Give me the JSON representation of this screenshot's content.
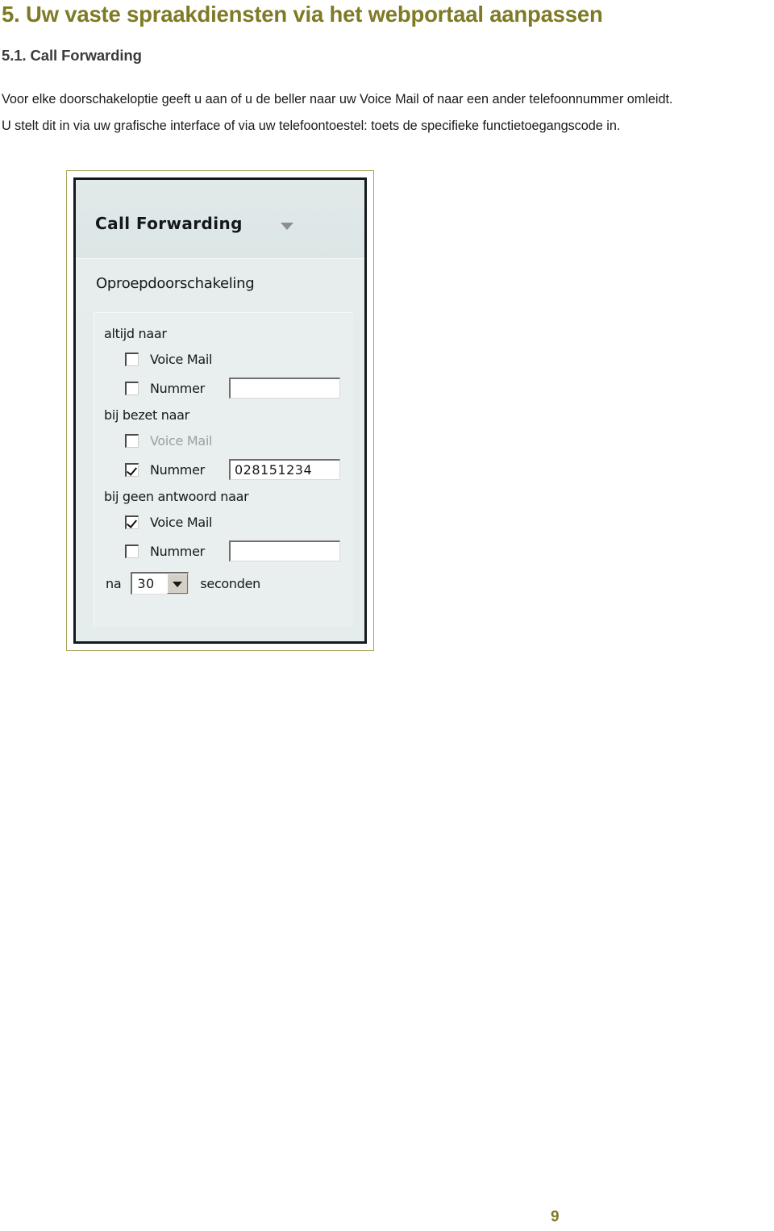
{
  "document": {
    "title": "5. Uw vaste spraakdiensten via het webportaal aanpassen",
    "section_title": "5.1. Call Forwarding",
    "paragraph_line_1": "Voor elke doorschakeloptie geeft u aan of u de beller naar uw Voice Mail of naar een ander telefoonnummer omleidt.",
    "paragraph_line_2": "U stelt dit in via uw grafische interface of via uw telefoontoestel: toets de specifieke functietoegangscode in.",
    "page_number": "9",
    "title_color": "#7e7a25",
    "section_title_color": "#3b3b3b"
  },
  "screenshot": {
    "panel_header_title": "Call Forwarding",
    "panel_subtitle": "Oproepdoorschakeling",
    "groups": [
      {
        "label": "altijd naar",
        "rows": [
          {
            "checked": false,
            "label": "Voice Mail",
            "dimmed": false,
            "has_input": false,
            "value": ""
          },
          {
            "checked": false,
            "label": "Nummer",
            "dimmed": false,
            "has_input": true,
            "value": ""
          }
        ]
      },
      {
        "label": "bij bezet naar",
        "rows": [
          {
            "checked": false,
            "label": "Voice Mail",
            "dimmed": true,
            "has_input": false,
            "value": ""
          },
          {
            "checked": true,
            "label": "Nummer",
            "dimmed": false,
            "has_input": true,
            "value": "028151234"
          }
        ]
      },
      {
        "label": "bij geen antwoord naar",
        "rows": [
          {
            "checked": true,
            "label": "Voice Mail",
            "dimmed": false,
            "has_input": false,
            "value": ""
          },
          {
            "checked": false,
            "label": "Nummer",
            "dimmed": false,
            "has_input": true,
            "value": ""
          }
        ]
      }
    ],
    "timeout": {
      "prefix": "na",
      "value": "30",
      "suffix": "seconden",
      "caret_icon": "chevron-down-icon"
    },
    "colors": {
      "panel_background": "#e5ecec",
      "frame_border": "#a9a45e",
      "inner_border": "#15181c"
    }
  }
}
